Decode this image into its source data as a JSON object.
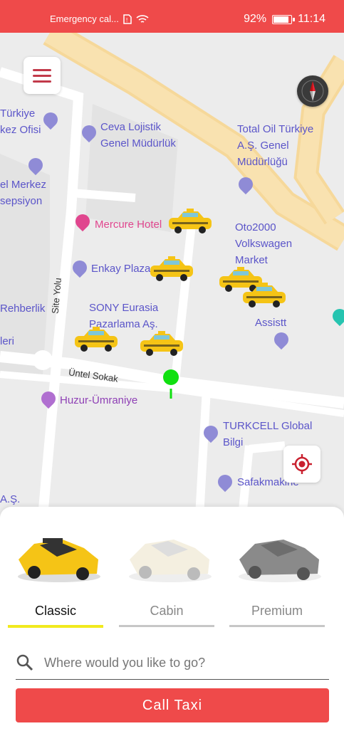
{
  "status_bar": {
    "carrier": "Emergency cal...",
    "battery": "92%",
    "time": "11:14"
  },
  "map": {
    "pois": [
      {
        "label": "Türkiye\nkez Ofisi",
        "color": "blue"
      },
      {
        "label": "Ceva Lojistik\nGenel Müdürlük",
        "color": "blue"
      },
      {
        "label": "Total Oil Türkiye\nA.Ş. Genel\nMüdürlüğü",
        "color": "blue"
      },
      {
        "label": "el Merkez\nsepsiyon",
        "color": "blue"
      },
      {
        "label": "Mercure Hotel",
        "color": "pink"
      },
      {
        "label": "Oto2000\nVolkswagen\nMarket",
        "color": "blue"
      },
      {
        "label": "Enkay Plaza",
        "color": "blue"
      },
      {
        "label": "Site Yolu",
        "color": "gray"
      },
      {
        "label": "Rehberlik",
        "color": "blue"
      },
      {
        "label": "leri",
        "color": "blue"
      },
      {
        "label": "SONY Eurasia\nPazarlama Aş.",
        "color": "blue"
      },
      {
        "label": "Assistt",
        "color": "blue"
      },
      {
        "label": "Üntel Sokak",
        "color": "gray"
      },
      {
        "label": "Huzur-Ümraniye",
        "color": "purple"
      },
      {
        "label": "TURKCELL Global\nBilgi",
        "color": "blue"
      },
      {
        "label": "Safakmakine",
        "color": "blue"
      },
      {
        "label": "A.Ş.",
        "color": "blue"
      }
    ]
  },
  "vehicle_types": [
    {
      "label": "Classic",
      "icon": "yellow-taxi-icon",
      "selected": true
    },
    {
      "label": "Cabin",
      "icon": "white-car-icon",
      "selected": false
    },
    {
      "label": "Premium",
      "icon": "gray-car-icon",
      "selected": false
    }
  ],
  "search": {
    "placeholder": "Where would you like to go?"
  },
  "call_button": {
    "label": "Call Taxi"
  },
  "colors": {
    "brand": "#ef4a4a",
    "selected_tab": "#f1ea1e",
    "taxi": "#f5c416"
  }
}
